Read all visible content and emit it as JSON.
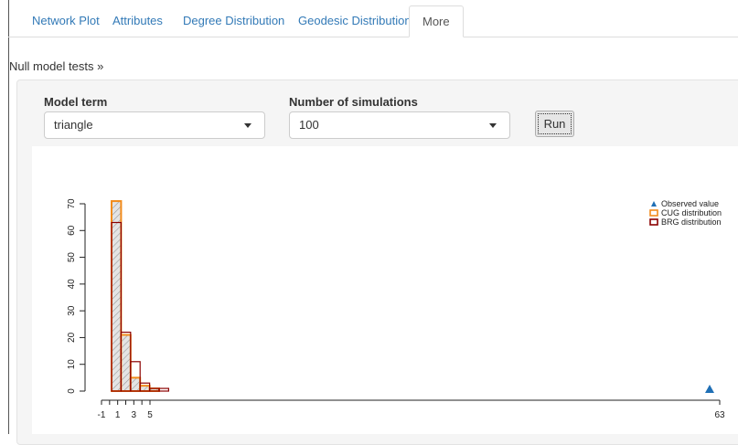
{
  "tabs": [
    {
      "label": "Network Plot",
      "active": false
    },
    {
      "label": "Attributes",
      "active": false
    },
    {
      "label": "Degree Distribution",
      "active": false
    },
    {
      "label": "Geodesic Distribution",
      "active": false
    },
    {
      "label": "More",
      "active": true
    }
  ],
  "section": {
    "toggle_label": "Null model tests »"
  },
  "controls": {
    "model_term_label": "Model term",
    "model_term_value": "triangle",
    "num_sims_label": "Number of simulations",
    "num_sims_value": "100",
    "run_label": "Run"
  },
  "colors": {
    "link": "#337ab7",
    "cug": "#f28c1c",
    "brg": "#8b0000",
    "observed": "#1f6fb5"
  },
  "chart_data": {
    "type": "bar",
    "y_ticks": [
      "0",
      "10",
      "20",
      "30",
      "40",
      "50",
      "60",
      "70"
    ],
    "x_tick_labels": [
      "-1",
      "1",
      "3",
      "5",
      "63"
    ],
    "x_tick_values": [
      -1,
      1,
      3,
      5,
      63
    ],
    "legend": [
      {
        "label": "Observed value",
        "symbol": "triangle"
      },
      {
        "label": "CUG distribution",
        "symbol": "square-orange"
      },
      {
        "label": "BRG distribution",
        "symbol": "square-darkred"
      }
    ],
    "bin_edges": [
      0,
      1,
      2,
      3,
      4,
      5,
      6
    ],
    "series": [
      {
        "name": "CUG distribution",
        "values": [
          71,
          21,
          5,
          2,
          1,
          0
        ]
      },
      {
        "name": "BRG distribution",
        "values": [
          63,
          22,
          11,
          3,
          1,
          1
        ]
      }
    ],
    "observed_value": 63,
    "ylim": [
      0,
      72
    ],
    "legend_position": "top-right"
  }
}
